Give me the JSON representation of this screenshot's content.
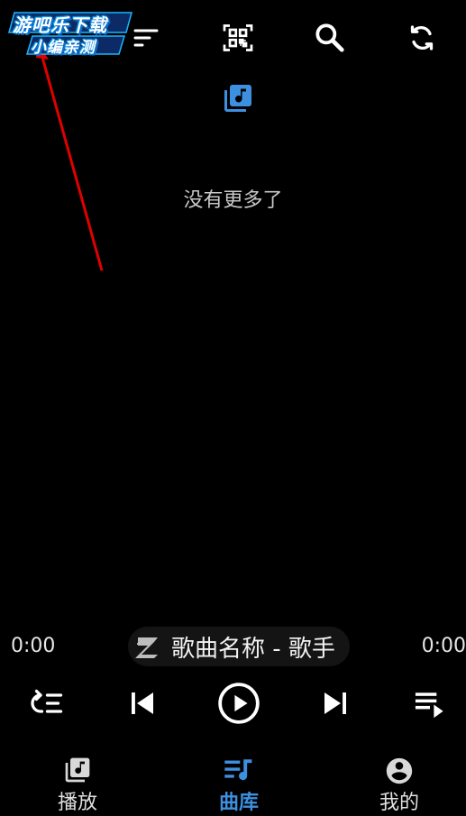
{
  "watermark": {
    "line1": "游吧乐下载",
    "line2": "小编亲测"
  },
  "toolbar": {
    "icons": [
      "menu-icon",
      "sort-icon",
      "qr-scan-icon",
      "search-icon",
      "refresh-icon"
    ]
  },
  "library": {
    "header_icon": "music-library-icon",
    "empty_message": "没有更多了"
  },
  "player": {
    "time_elapsed": "0:00",
    "time_total": "0:00",
    "song_label": "歌曲名称 - 歌手",
    "controls": [
      "repeat-list-icon",
      "previous-icon",
      "play-icon",
      "next-icon",
      "playlist-icon"
    ]
  },
  "bottom_nav": {
    "active": "曲库",
    "items": [
      {
        "label": "播放",
        "icon": "music-library-icon"
      },
      {
        "label": "曲库",
        "icon": "music-list-icon"
      },
      {
        "label": "我的",
        "icon": "account-icon"
      }
    ]
  },
  "colors": {
    "accent": "#3d8fe0",
    "background": "#000000",
    "annotation": "#e00000"
  }
}
